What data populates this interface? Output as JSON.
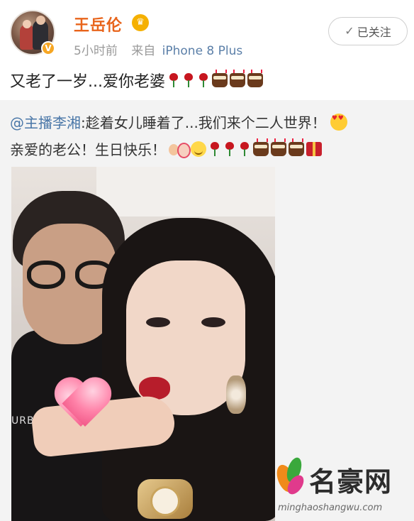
{
  "post": {
    "username": "王岳伦",
    "time": "5小时前",
    "source_prefix": "来自",
    "source_device": "iPhone 8 Plus",
    "follow_label": "已关注",
    "text": "又老了一岁...爱你老婆"
  },
  "repost": {
    "mention": "@主播李湘",
    "line1_text": ":趁着女儿睡着了...我们来个二人世界！",
    "line2_text": "亲爱的老公！生日快乐！"
  },
  "photo": {
    "shirt_text": "URBERRY"
  },
  "watermark": {
    "name": "名豪网",
    "url": "minghaoshangwu.com"
  },
  "icons": {
    "vip": "v-badge-icon",
    "crown": "crown-icon",
    "check": "check-icon",
    "rose": "rose-emoji-icon",
    "cake": "cake-emoji-icon",
    "heart_eyes": "heart-eyes-emoji-icon",
    "kiss": "kiss-emoji-icon",
    "smile": "smile-emoji-icon",
    "gift": "gift-emoji-icon"
  },
  "colors": {
    "username": "#e8641b",
    "mention": "#4a77a8",
    "device": "#5b7fa8",
    "repost_bg": "#f3f3f3"
  }
}
